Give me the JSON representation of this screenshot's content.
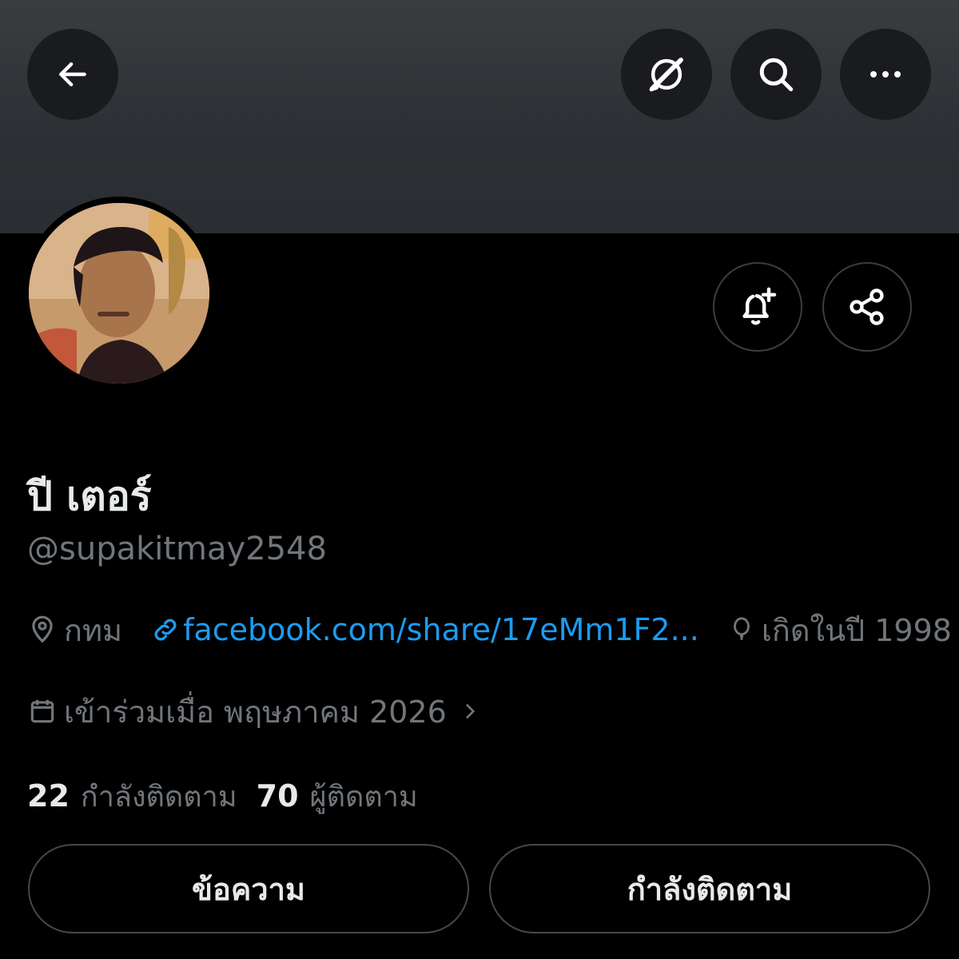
{
  "profile": {
    "display_name": "ปี เตอร์",
    "handle": "@supakitmay2548",
    "location": "กทม",
    "link": "facebook.com/share/17eMm1F2...",
    "birth": "เกิดในปี 1998",
    "joined": "เข้าร่วมเมื่อ พฤษภาคม 2026"
  },
  "stats": {
    "following_count": "22",
    "following_label": "กำลังติดตาม",
    "followers_count": "70",
    "followers_label": "ผู้ติดตาม"
  },
  "actions": {
    "message_label": "ข้อความ",
    "following_button_label": "กำลังติดตาม"
  },
  "icons": {
    "back": "arrow-left-icon",
    "grok": "grok-icon",
    "search": "search-icon",
    "more": "more-horizontal-icon",
    "notify": "bell-plus-icon",
    "share": "share-icon",
    "location": "location-pin-icon",
    "link": "link-icon",
    "birth": "balloon-icon",
    "joined": "calendar-icon",
    "chevron": "chevron-right-icon"
  },
  "colors": {
    "background": "#000000",
    "banner": "#2c2f33",
    "text_primary": "#e7e9ea",
    "text_secondary": "#71767b",
    "link": "#1d9bf0",
    "border": "#44474c"
  }
}
